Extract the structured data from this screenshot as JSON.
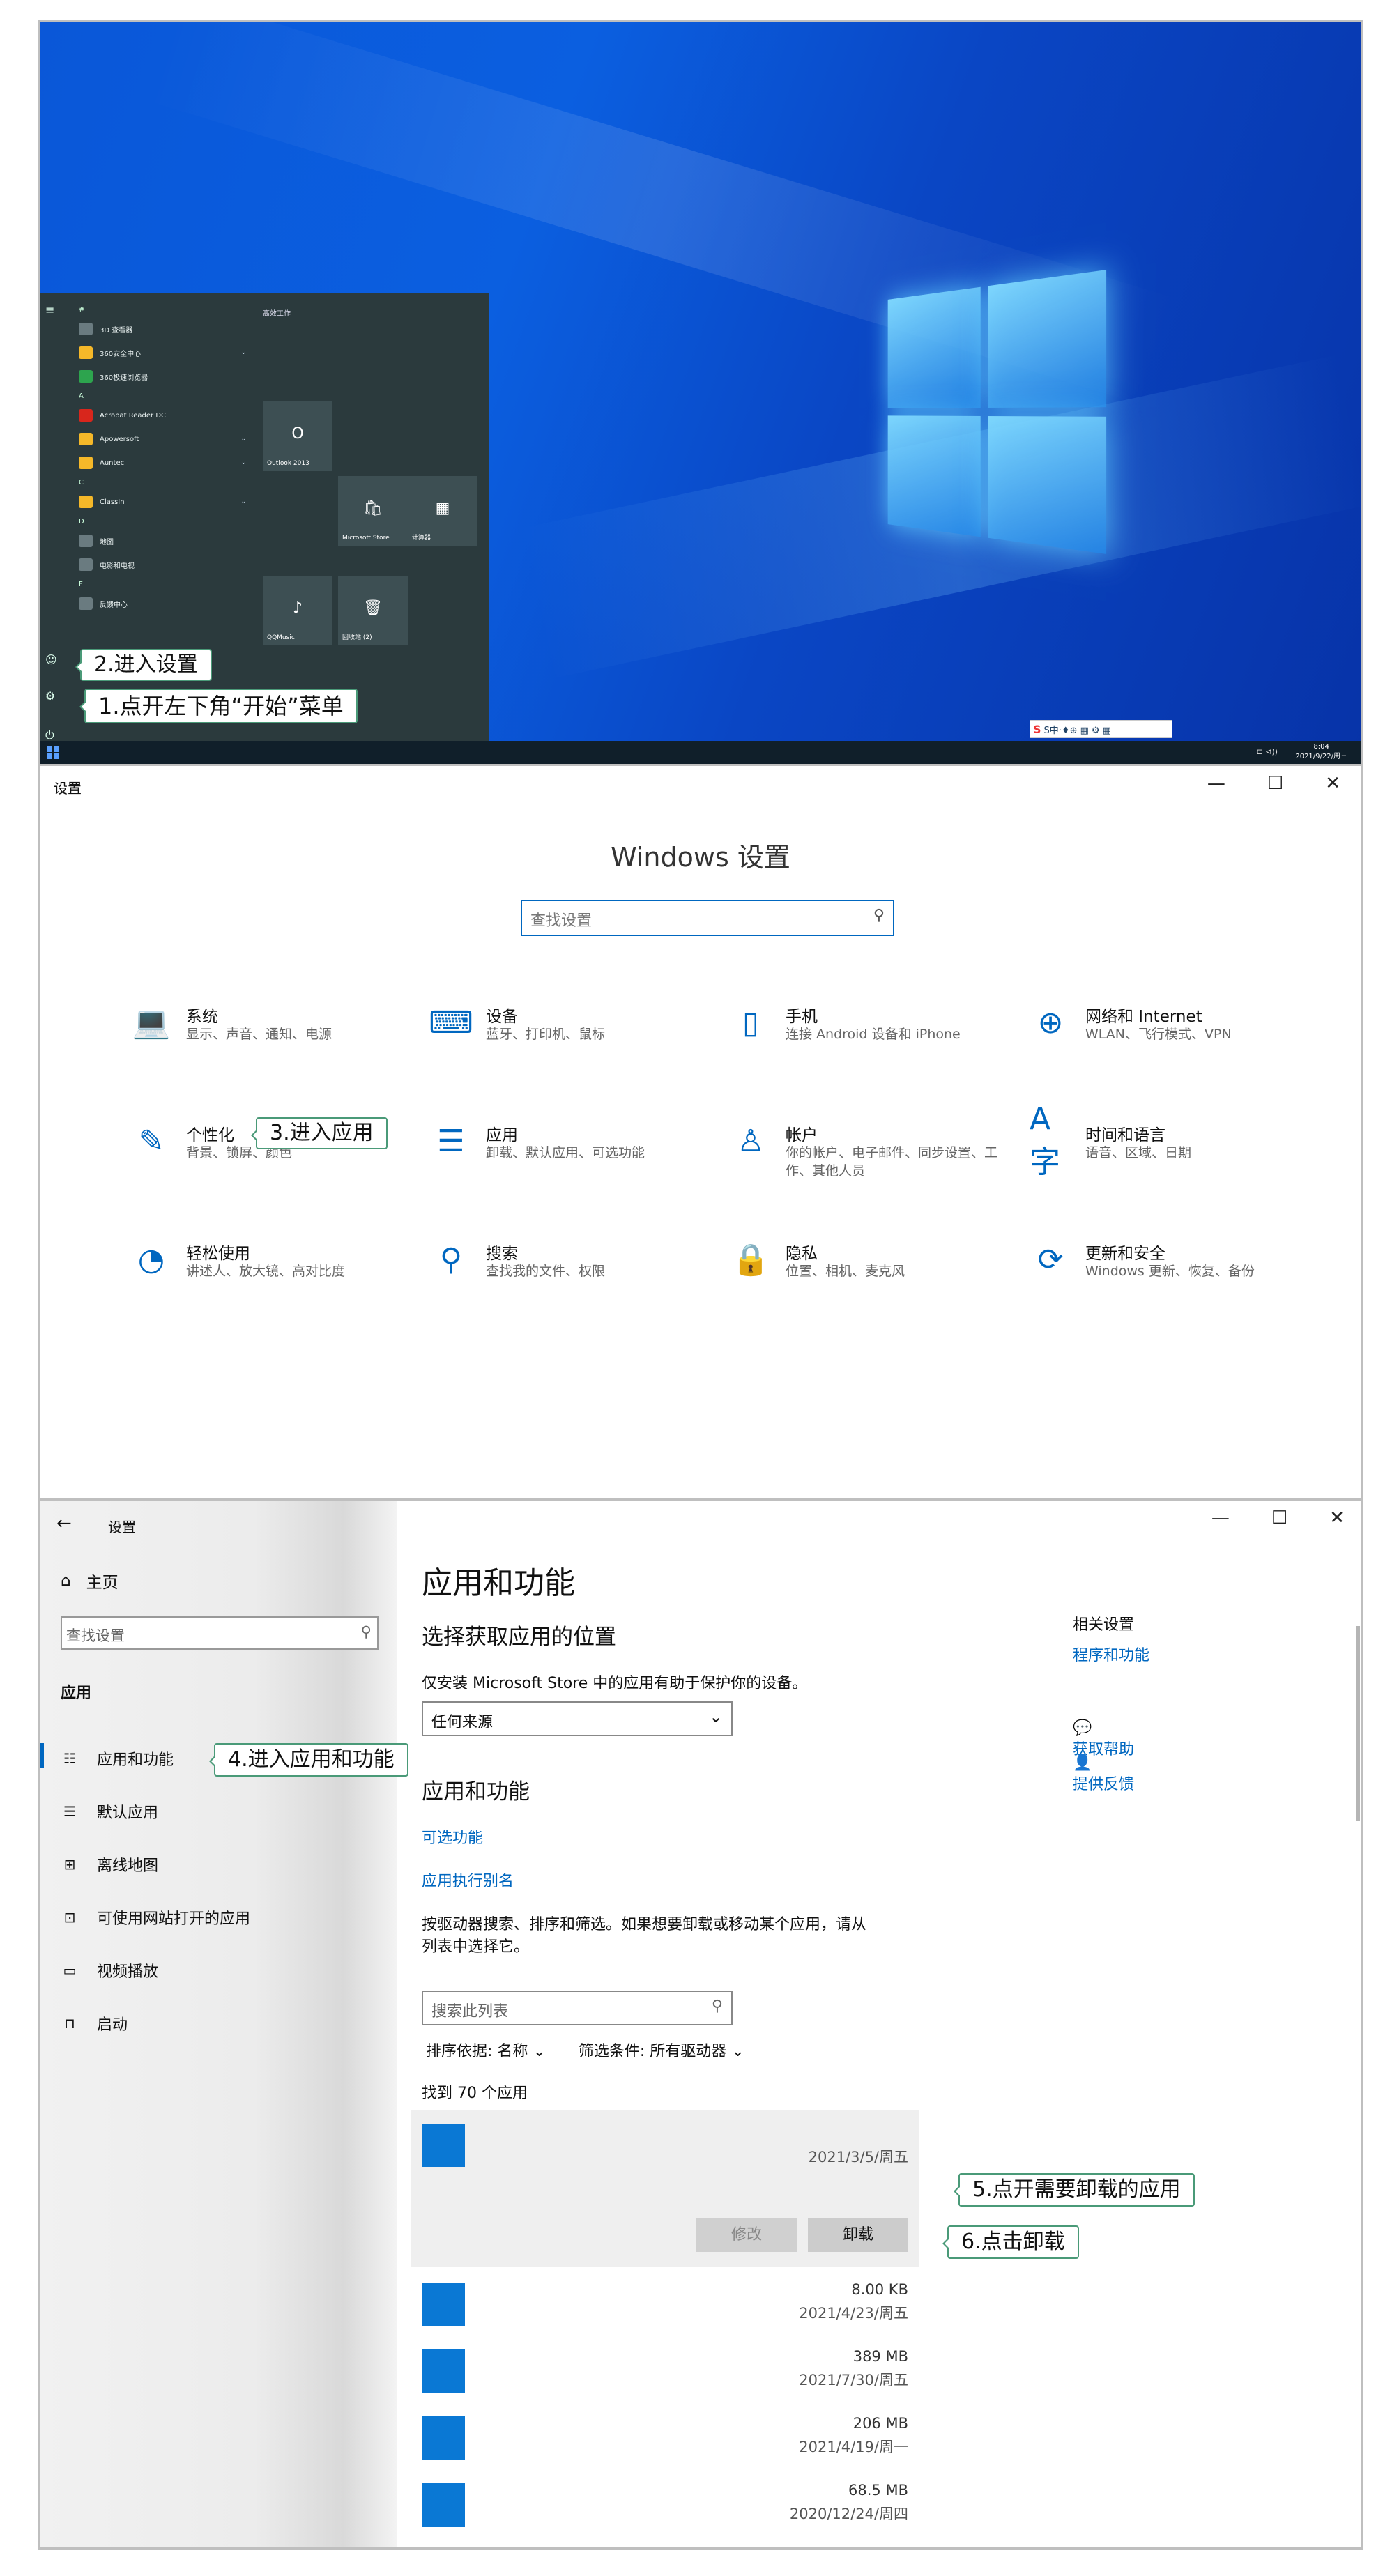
{
  "desktop": {
    "start_menu": {
      "group_title": "高效工作",
      "items": [
        {
          "kind": "letter",
          "label": "#"
        },
        {
          "kind": "app",
          "label": "3D 查看器",
          "color": "#6a7b80"
        },
        {
          "kind": "folder",
          "label": "360安全中心",
          "color": "#f5b829",
          "chevron": "⌄"
        },
        {
          "kind": "app",
          "label": "360极速浏览器",
          "color": "#2da44e"
        },
        {
          "kind": "letter",
          "label": "A"
        },
        {
          "kind": "app",
          "label": "Acrobat Reader DC",
          "color": "#d8261c"
        },
        {
          "kind": "folder",
          "label": "Apowersoft",
          "color": "#f5b829",
          "chevron": "⌄"
        },
        {
          "kind": "folder",
          "label": "Auntec",
          "color": "#f5b829",
          "chevron": "⌄"
        },
        {
          "kind": "letter",
          "label": "C"
        },
        {
          "kind": "folder",
          "label": "ClassIn",
          "color": "#f5b829",
          "chevron": "⌄"
        },
        {
          "kind": "letter",
          "label": "D"
        },
        {
          "kind": "app",
          "label": "地图",
          "color": "#6a7b80"
        },
        {
          "kind": "app",
          "label": "电影和电视",
          "color": "#6a7b80"
        },
        {
          "kind": "letter",
          "label": "F"
        },
        {
          "kind": "app",
          "label": "反馈中心",
          "color": "#6a7b80"
        }
      ],
      "tiles": [
        {
          "label": "Outlook 2013",
          "glyph": "O"
        },
        {
          "label": "Microsoft Store",
          "glyph": "🛍"
        },
        {
          "label": "计算器",
          "glyph": "▦"
        },
        {
          "label": "QQMusic",
          "glyph": "♪"
        },
        {
          "label": "回收站 (2)",
          "glyph": "🗑"
        }
      ]
    },
    "taskbar": {
      "time": "8:04",
      "date": "2021/9/22/周三",
      "tray": "⊏ ⊲))"
    },
    "ime_bar": "S中·♦⊕ ▦ ⚙ ▦",
    "callouts": {
      "step1": "1.点开左下角“开始”菜单",
      "step2": "2.进入设置"
    }
  },
  "settings": {
    "window_title": "设置",
    "controls": {
      "min": "—",
      "max": "☐",
      "close": "✕"
    },
    "heading": "Windows 设置",
    "search_placeholder": "查找设置",
    "categories": [
      {
        "name": "系统",
        "desc": "显示、声音、通知、电源",
        "icon": "laptop-icon",
        "glyph": "💻"
      },
      {
        "name": "设备",
        "desc": "蓝牙、打印机、鼠标",
        "icon": "devices-icon",
        "glyph": "⌨"
      },
      {
        "name": "手机",
        "desc": "连接 Android 设备和 iPhone",
        "icon": "phone-icon",
        "glyph": "▯"
      },
      {
        "name": "网络和 Internet",
        "desc": "WLAN、飞行模式、VPN",
        "icon": "globe-icon",
        "glyph": "⊕"
      },
      {
        "name": "个性化",
        "desc": "背景、锁屏、颜色",
        "icon": "personalize-icon",
        "glyph": "✎"
      },
      {
        "name": "应用",
        "desc": "卸载、默认应用、可选功能",
        "icon": "apps-list-icon",
        "glyph": "☰"
      },
      {
        "name": "帐户",
        "desc": "你的帐户、电子邮件、同步设置、工作、其他人员",
        "icon": "person-icon",
        "glyph": "♙"
      },
      {
        "name": "时间和语言",
        "desc": "语音、区域、日期",
        "icon": "time-language-icon",
        "glyph": "A字"
      },
      {
        "name": "轻松使用",
        "desc": "讲述人、放大镜、高对比度",
        "icon": "ease-access-icon",
        "glyph": "◔"
      },
      {
        "name": "搜索",
        "desc": "查找我的文件、权限",
        "icon": "search-icon",
        "glyph": "⚲"
      },
      {
        "name": "隐私",
        "desc": "位置、相机、麦克风",
        "icon": "lock-icon",
        "glyph": "🔒"
      },
      {
        "name": "更新和安全",
        "desc": "Windows 更新、恢复、备份",
        "icon": "update-icon",
        "glyph": "⟳"
      }
    ],
    "callout": "3.进入应用"
  },
  "apps": {
    "window_title": "设置",
    "sidebar": {
      "home": "主页",
      "search_placeholder": "查找设置",
      "section": "应用",
      "items": [
        {
          "label": "应用和功能",
          "icon": "apps-features-icon",
          "glyph": "☷"
        },
        {
          "label": "默认应用",
          "icon": "default-apps-icon",
          "glyph": "☰"
        },
        {
          "label": "离线地图",
          "icon": "offline-maps-icon",
          "glyph": "⊞"
        },
        {
          "label": "可使用网站打开的应用",
          "icon": "website-apps-icon",
          "glyph": "⊡"
        },
        {
          "label": "视频播放",
          "icon": "video-icon",
          "glyph": "▭"
        },
        {
          "label": "启动",
          "icon": "startup-icon",
          "glyph": "⊓"
        }
      ]
    },
    "main": {
      "title": "应用和功能",
      "choose_heading": "选择获取应用的位置",
      "choose_desc": "仅安装 Microsoft Store 中的应用有助于保护你的设备。",
      "source_select": "任何来源",
      "section_heading": "应用和功能",
      "optional_features": "可选功能",
      "app_alias": "应用执行别名",
      "search_desc_1": "按驱动器搜索、排序和筛选。如果想要卸载或移动某个应用，请从",
      "search_desc_2": "列表中选择它。",
      "list_search_placeholder": "搜索此列表",
      "sort_label": "排序依据:",
      "sort_value": "名称",
      "filter_label": "筛选条件:",
      "filter_value": "所有驱动器",
      "found_count": "找到 70 个应用",
      "selected_app": {
        "date": "2021/3/5/周五",
        "modify": "修改",
        "uninstall": "卸载"
      },
      "rows": [
        {
          "size": "8.00 KB",
          "date": "2021/4/23/周五"
        },
        {
          "size": "389 MB",
          "date": "2021/7/30/周五"
        },
        {
          "size": "206 MB",
          "date": "2021/4/19/周一"
        },
        {
          "size": "68.5 MB",
          "date": "2020/12/24/周四"
        }
      ]
    },
    "related": {
      "heading": "相关设置",
      "programs": "程序和功能",
      "help": "获取帮助",
      "feedback": "提供反馈"
    },
    "callouts": {
      "step4": "4.进入应用和功能",
      "step5": "5.点开需要卸载的应用",
      "step6": "6.点击卸载"
    }
  }
}
